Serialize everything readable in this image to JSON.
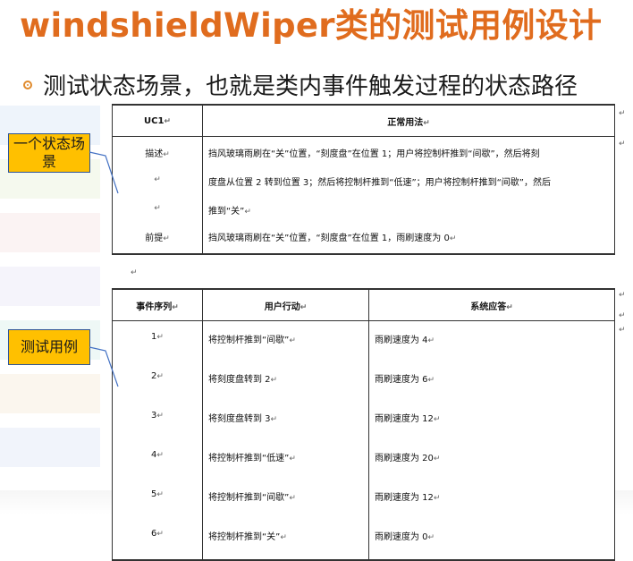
{
  "slide": {
    "title": "windshieldWiper类的测试用例设计",
    "bullet": "测试状态场景，也就是类内事件触发过程的状态路径",
    "callouts": [
      "一个状态场景",
      "测试用例"
    ],
    "colors": {
      "title": "#e06c1e",
      "callout_fill": "#ffc000",
      "callout_border": "#2f5597"
    }
  },
  "usecase_table": {
    "header_left": "UC1",
    "header_right": "正常用法",
    "rows": [
      {
        "label": "描述",
        "text": "挡风玻璃雨刷在“关”位置，“刻度盘”在位置 1；用户将控制杆推到“间歇”，然后将刻"
      },
      {
        "label": "",
        "text": "度盘从位置 2 转到位置 3；然后将控制杆推到“低速”；用户将控制杆推到“间歇”，然后"
      },
      {
        "label": "",
        "text": "推到“关”"
      },
      {
        "label": "前提",
        "text": "挡风玻璃雨刷在“关”位置，“刻度盘”在位置 1，雨刷速度为 0"
      }
    ]
  },
  "event_table": {
    "headers": [
      "事件序列",
      "用户行动",
      "系统应答"
    ],
    "rows": [
      {
        "seq": "1",
        "action": "将控制杆推到“间歇”",
        "response": "雨刷速度为 4"
      },
      {
        "seq": "2",
        "action": "将刻度盘转到 2",
        "response": "雨刷速度为 6"
      },
      {
        "seq": "3",
        "action": "将刻度盘转到 3",
        "response": "雨刷速度为 12"
      },
      {
        "seq": "4",
        "action": "将控制杆推到“低速”",
        "response": "雨刷速度为 20"
      },
      {
        "seq": "5",
        "action": "将控制杆推到“间歇”",
        "response": "雨刷速度为 12"
      },
      {
        "seq": "6",
        "action": "将控制杆推到“关”",
        "response": "雨刷速度为 0"
      }
    ]
  }
}
